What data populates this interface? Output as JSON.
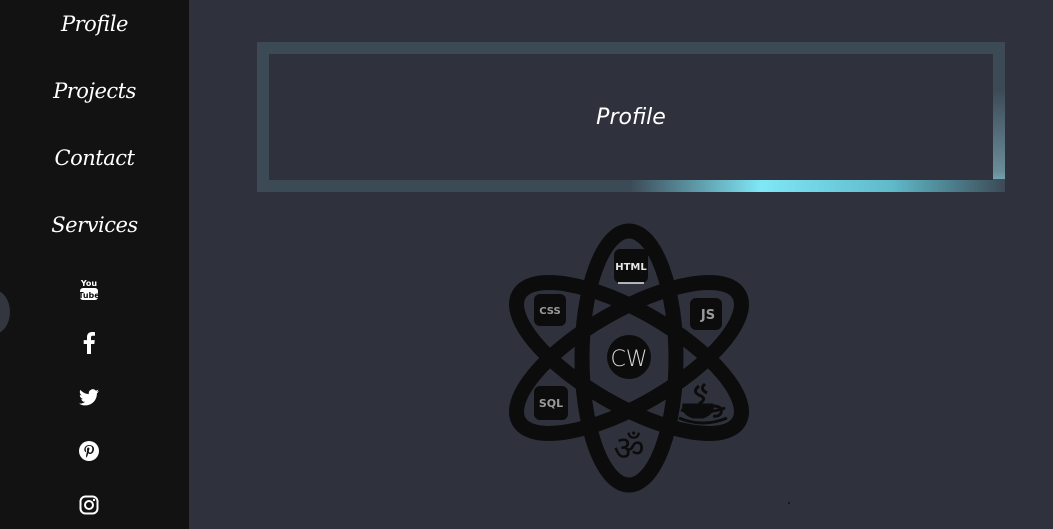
{
  "sidebar": {
    "nav": [
      {
        "label": "Profile"
      },
      {
        "label": "Projects"
      },
      {
        "label": "Contact"
      },
      {
        "label": "Services"
      }
    ],
    "social": [
      "youtube-icon",
      "facebook-icon",
      "twitter-icon",
      "pinterest-icon",
      "instagram-icon"
    ]
  },
  "main": {
    "title": "Profile",
    "logo": {
      "monogram": "CW",
      "badges": [
        "HTML",
        "CSS",
        "JS",
        "SQL"
      ],
      "icons": [
        "java-icon",
        "om-icon"
      ]
    }
  },
  "colors": {
    "background": "#2f323c",
    "sidebar": "#121212",
    "frame": "#3c4a56",
    "accent": "#7fe7f7"
  }
}
